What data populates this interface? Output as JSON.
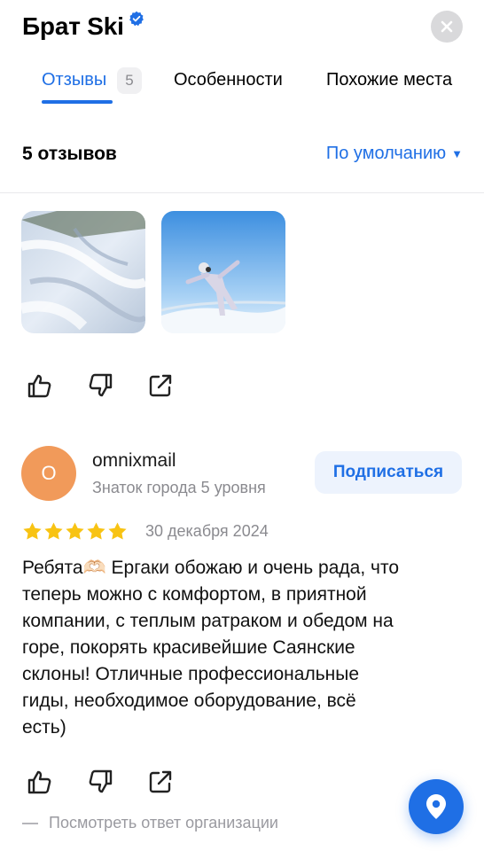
{
  "header": {
    "title": "Брат Ski",
    "verified_icon": "verified-badge-icon",
    "close_icon": "close-icon"
  },
  "tabs": {
    "partial_left": "",
    "items": [
      {
        "label": "Отзывы",
        "count": "5",
        "active": true
      },
      {
        "label": "Особенности",
        "active": false
      },
      {
        "label": "Похожие места",
        "active": false
      }
    ]
  },
  "summary": {
    "review_count": "5 отзывов",
    "sort_label": "По умолчанию",
    "sort_arrow": "▼"
  },
  "photos": [
    {
      "name": "snow-slope-photo"
    },
    {
      "name": "snowboarder-photo"
    }
  ],
  "review": {
    "avatar_letter": "O",
    "avatar_color": "#f19a5a",
    "username": "omnixmail",
    "level": "Знаток города 5 уровня",
    "subscribe_label": "Подписаться",
    "rating": 5,
    "date": "30 декабря 2024",
    "text": "Ребята🫶🏻 Ергаки обожаю и очень рада, что\nтеперь можно с комфортом, в приятной\nкомпании, с теплым ратраком и обедом на\nгоре, покорять красивейшие Саянские\nсклоны! Отличные профессиональные\nгиды, необходимое оборудование, всё\nесть)"
  },
  "org_reply_label": "Посмотреть ответ организации",
  "colors": {
    "accent": "#1f6fe5",
    "star": "#f8c313",
    "muted": "#8a8a8f"
  }
}
